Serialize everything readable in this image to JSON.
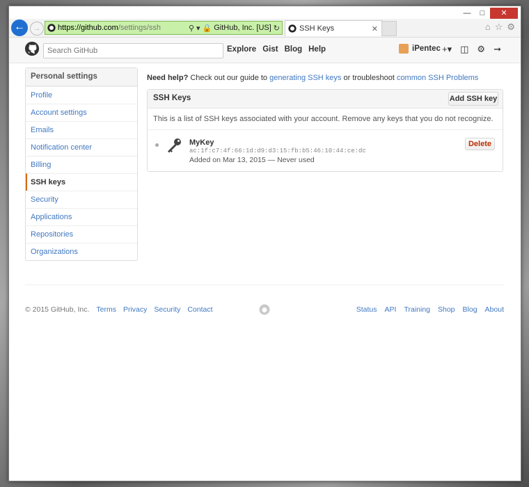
{
  "browser": {
    "url_host": "https://github.com",
    "url_path": "/settings/ssh",
    "cert_label": "GitHub, Inc. [US]",
    "tab_title": "SSH Keys"
  },
  "header": {
    "search_placeholder": "Search GitHub",
    "nav": [
      "Explore",
      "Gist",
      "Blog",
      "Help"
    ],
    "username": "iPentec"
  },
  "sidebar": {
    "title": "Personal settings",
    "items": [
      {
        "label": "Profile"
      },
      {
        "label": "Account settings"
      },
      {
        "label": "Emails"
      },
      {
        "label": "Notification center"
      },
      {
        "label": "Billing"
      },
      {
        "label": "SSH keys",
        "selected": true
      },
      {
        "label": "Security"
      },
      {
        "label": "Applications"
      },
      {
        "label": "Repositories"
      },
      {
        "label": "Organizations"
      }
    ]
  },
  "help": {
    "prefix": "Need help?",
    "text1": " Check out our guide to ",
    "link1": "generating SSH keys",
    "text2": " or troubleshoot ",
    "link2": "common SSH Problems"
  },
  "ssh_panel": {
    "title": "SSH Keys",
    "add_button": "Add SSH key",
    "description": "This is a list of SSH keys associated with your account. Remove any keys that you do not recognize.",
    "keys": [
      {
        "name": "MyKey",
        "fingerprint": "ac:1f:c7:4f:66:1d:d9:d3:15:fb:b5:46:10:44:ce:dc",
        "meta": "Added on Mar 13, 2015 — Never used",
        "delete_label": "Delete"
      }
    ]
  },
  "footer": {
    "copyright": "© 2015 GitHub, Inc.",
    "left_links": [
      "Terms",
      "Privacy",
      "Security",
      "Contact"
    ],
    "right_links": [
      "Status",
      "API",
      "Training",
      "Shop",
      "Blog",
      "About"
    ]
  }
}
